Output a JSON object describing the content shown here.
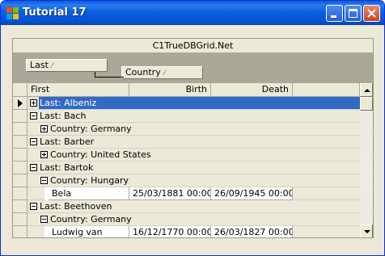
{
  "window": {
    "title": "Tutorial 17"
  },
  "grid": {
    "caption": "C1TrueDBGrid.Net",
    "group_columns": [
      {
        "label": "Last",
        "sort": "⁄"
      },
      {
        "label": "Country",
        "sort": "⁄"
      }
    ],
    "headers": {
      "first": "First",
      "birth": "Birth",
      "death": "Death"
    },
    "rows": [
      {
        "level": 0,
        "text": "Last: Albeniz",
        "expander": "plus",
        "active": true
      },
      {
        "level": 0,
        "text": "Last: Bach",
        "expander": "minus"
      },
      {
        "level": 1,
        "text": "Country: Germany",
        "expander": "plus"
      },
      {
        "level": 0,
        "text": "Last: Barber",
        "expander": "minus"
      },
      {
        "level": 1,
        "text": "Country: United States",
        "expander": "plus"
      },
      {
        "level": 0,
        "text": "Last: Bartok",
        "expander": "minus"
      },
      {
        "level": 1,
        "text": "Country: Hungary",
        "expander": "minus"
      },
      {
        "level": 2,
        "first": "Bela",
        "birth": "25/03/1881 00:00:",
        "death": "26/09/1945 00:00:"
      },
      {
        "level": 0,
        "text": "Last: Beethoven",
        "expander": "minus"
      },
      {
        "level": 1,
        "text": "Country: Germany",
        "expander": "minus"
      },
      {
        "level": 2,
        "first": "Ludwig van",
        "birth": "16/12/1770 00:00:",
        "death": "26/03/1827 00:00:"
      }
    ]
  },
  "colors": {
    "titlebar": "#0a5fe0",
    "selection": "#316ac5",
    "face": "#ece9d8",
    "group_area": "#aca899"
  }
}
